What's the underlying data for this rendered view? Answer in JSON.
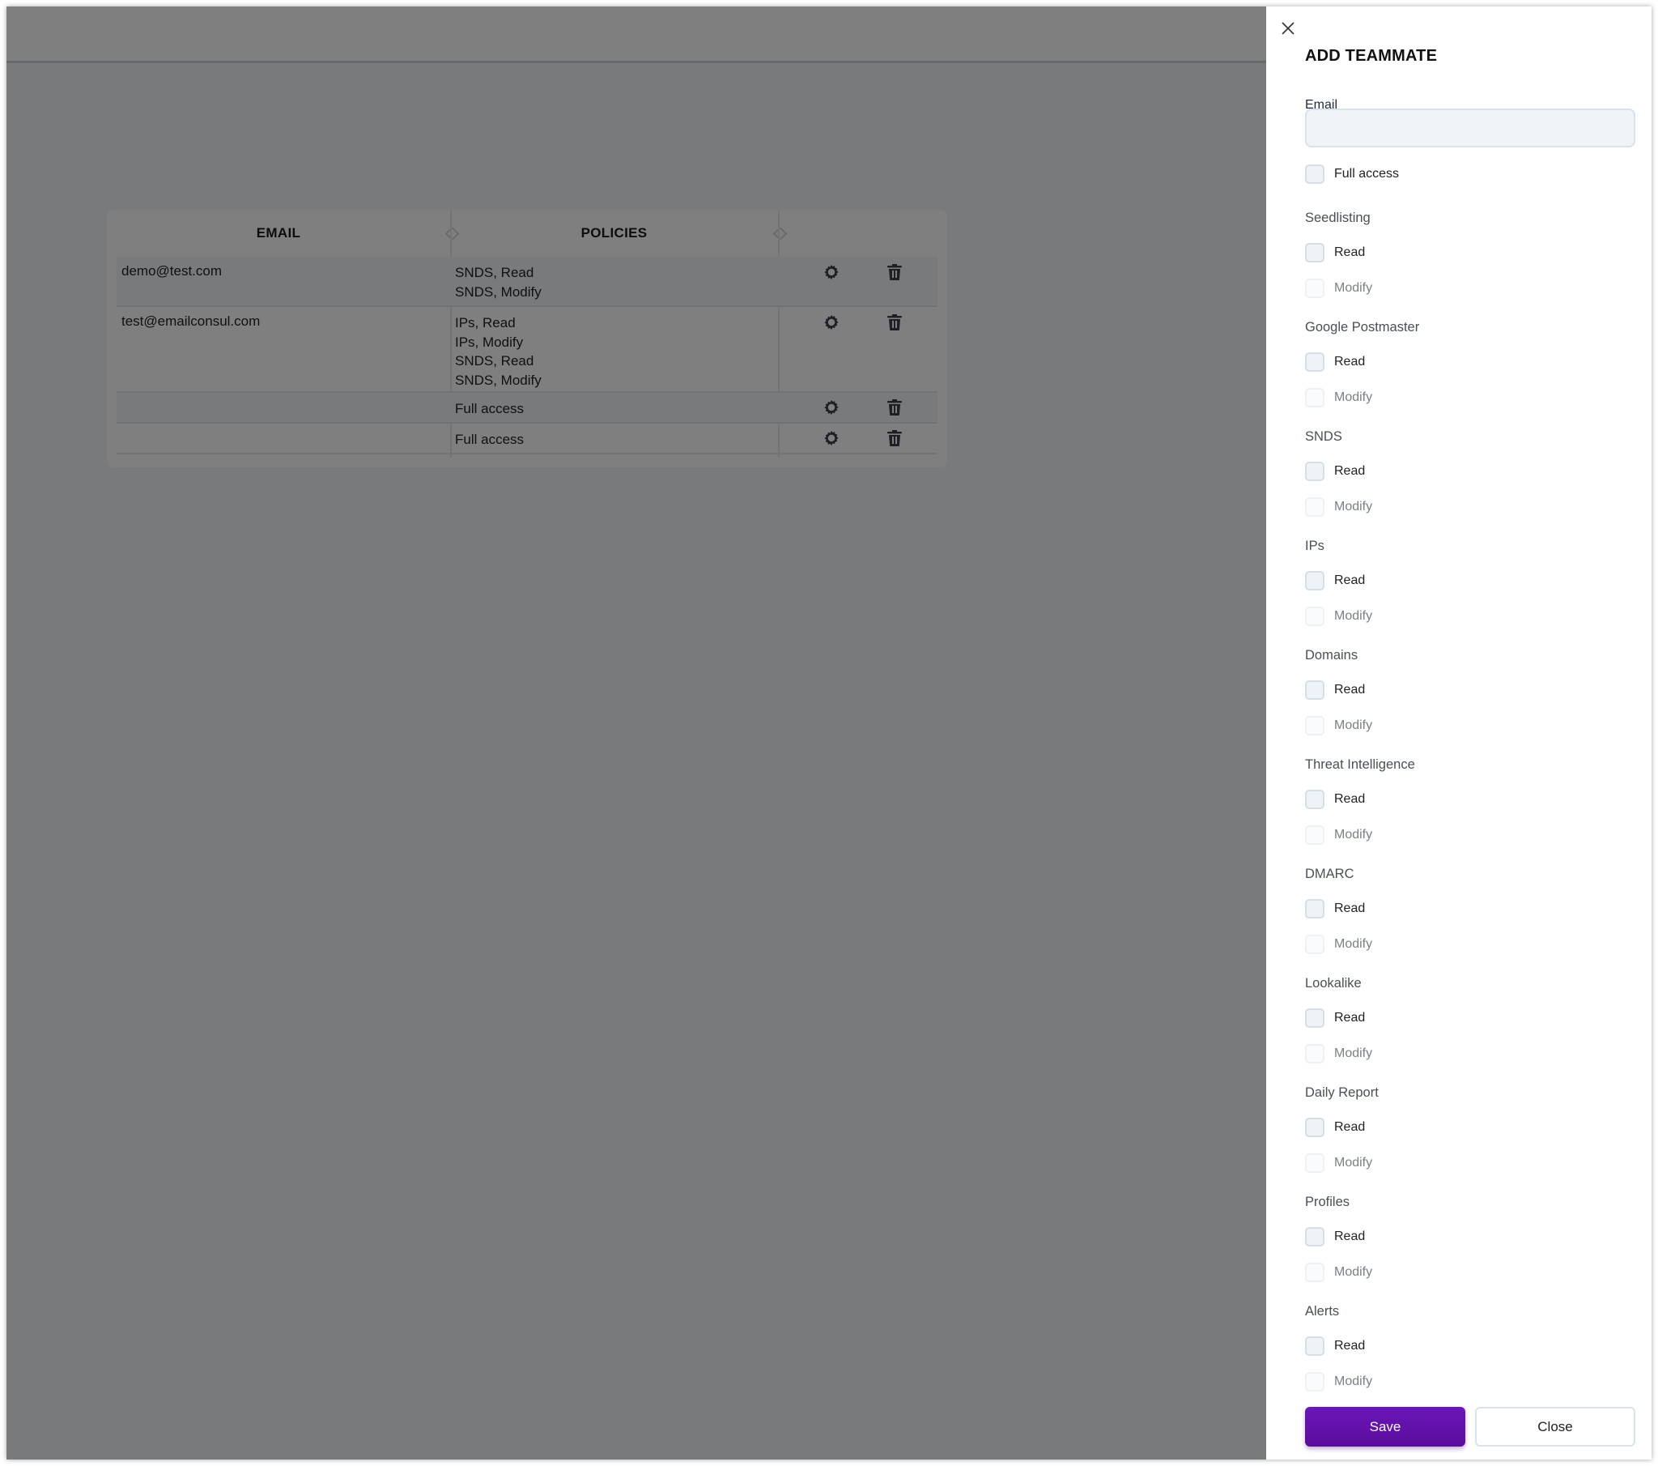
{
  "table": {
    "headers": {
      "email": "EMAIL",
      "policies": "POLICIES"
    },
    "rows": [
      {
        "email": "demo@test.com",
        "policies": [
          "SNDS, Read",
          "SNDS, Modify"
        ]
      },
      {
        "email": "test@emailconsul.com",
        "policies": [
          "IPs, Read",
          "IPs, Modify",
          "SNDS, Read",
          "SNDS, Modify"
        ]
      },
      {
        "email": "",
        "policies": [
          "Full access"
        ]
      },
      {
        "email": "",
        "policies": [
          "Full access"
        ]
      }
    ],
    "row_actions": {
      "settings_icon": "gear-icon",
      "delete_icon": "trash-icon"
    }
  },
  "drawer": {
    "title": "ADD TEAMMATE",
    "email_label": "Email",
    "email_value": "",
    "full_access_label": "Full access",
    "full_access_checked": false,
    "sections": [
      {
        "name": "Seedlisting",
        "read": "Read",
        "modify": "Modify"
      },
      {
        "name": "Google Postmaster",
        "read": "Read",
        "modify": "Modify"
      },
      {
        "name": "SNDS",
        "read": "Read",
        "modify": "Modify"
      },
      {
        "name": "IPs",
        "read": "Read",
        "modify": "Modify"
      },
      {
        "name": "Domains",
        "read": "Read",
        "modify": "Modify"
      },
      {
        "name": "Threat Intelligence",
        "read": "Read",
        "modify": "Modify"
      },
      {
        "name": "DMARC",
        "read": "Read",
        "modify": "Modify"
      },
      {
        "name": "Lookalike",
        "read": "Read",
        "modify": "Modify"
      },
      {
        "name": "Daily Report",
        "read": "Read",
        "modify": "Modify"
      },
      {
        "name": "Profiles",
        "read": "Read",
        "modify": "Modify"
      },
      {
        "name": "Alerts",
        "read": "Read",
        "modify": "Modify"
      }
    ],
    "save_label": "Save",
    "close_label": "Close",
    "close_icon": "close-icon"
  },
  "colors": {
    "accent": "#5a0d9c",
    "overlay": "rgba(0,0,0,0.5)"
  }
}
